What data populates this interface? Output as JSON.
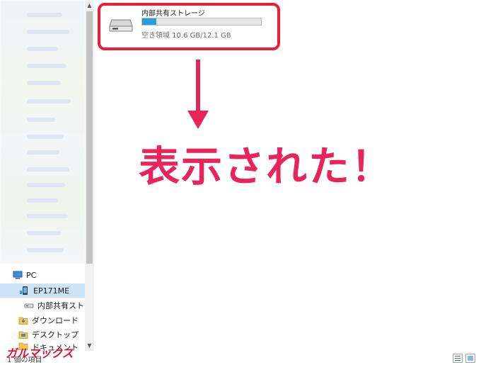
{
  "nav": {
    "pc_label": "PC",
    "device_label": "EP171ME",
    "storage_label": "内部共有ストレージ",
    "downloads_label": "ダウンロード",
    "desktop_label": "デスクトップ",
    "documents_label": "ドキュメント"
  },
  "drive": {
    "name": "内部共有ストレージ",
    "free_space": "空き領域 10.6 GB/12.1 GB",
    "used_fraction": 0.12
  },
  "status": {
    "item_count": "1 個の項目"
  },
  "annotation": {
    "text": "表示された！"
  },
  "watermark": {
    "text": "ガルマックス"
  },
  "colors": {
    "highlight": "#ee1c3a",
    "annotation": "#e8245a",
    "progress": "#26a0da",
    "selection": "#cce4f7"
  },
  "icons": {
    "pc": "pc-icon",
    "device": "device-icon",
    "drive": "drive-icon",
    "downloads": "download-folder-icon",
    "desktop": "desktop-folder-icon"
  }
}
